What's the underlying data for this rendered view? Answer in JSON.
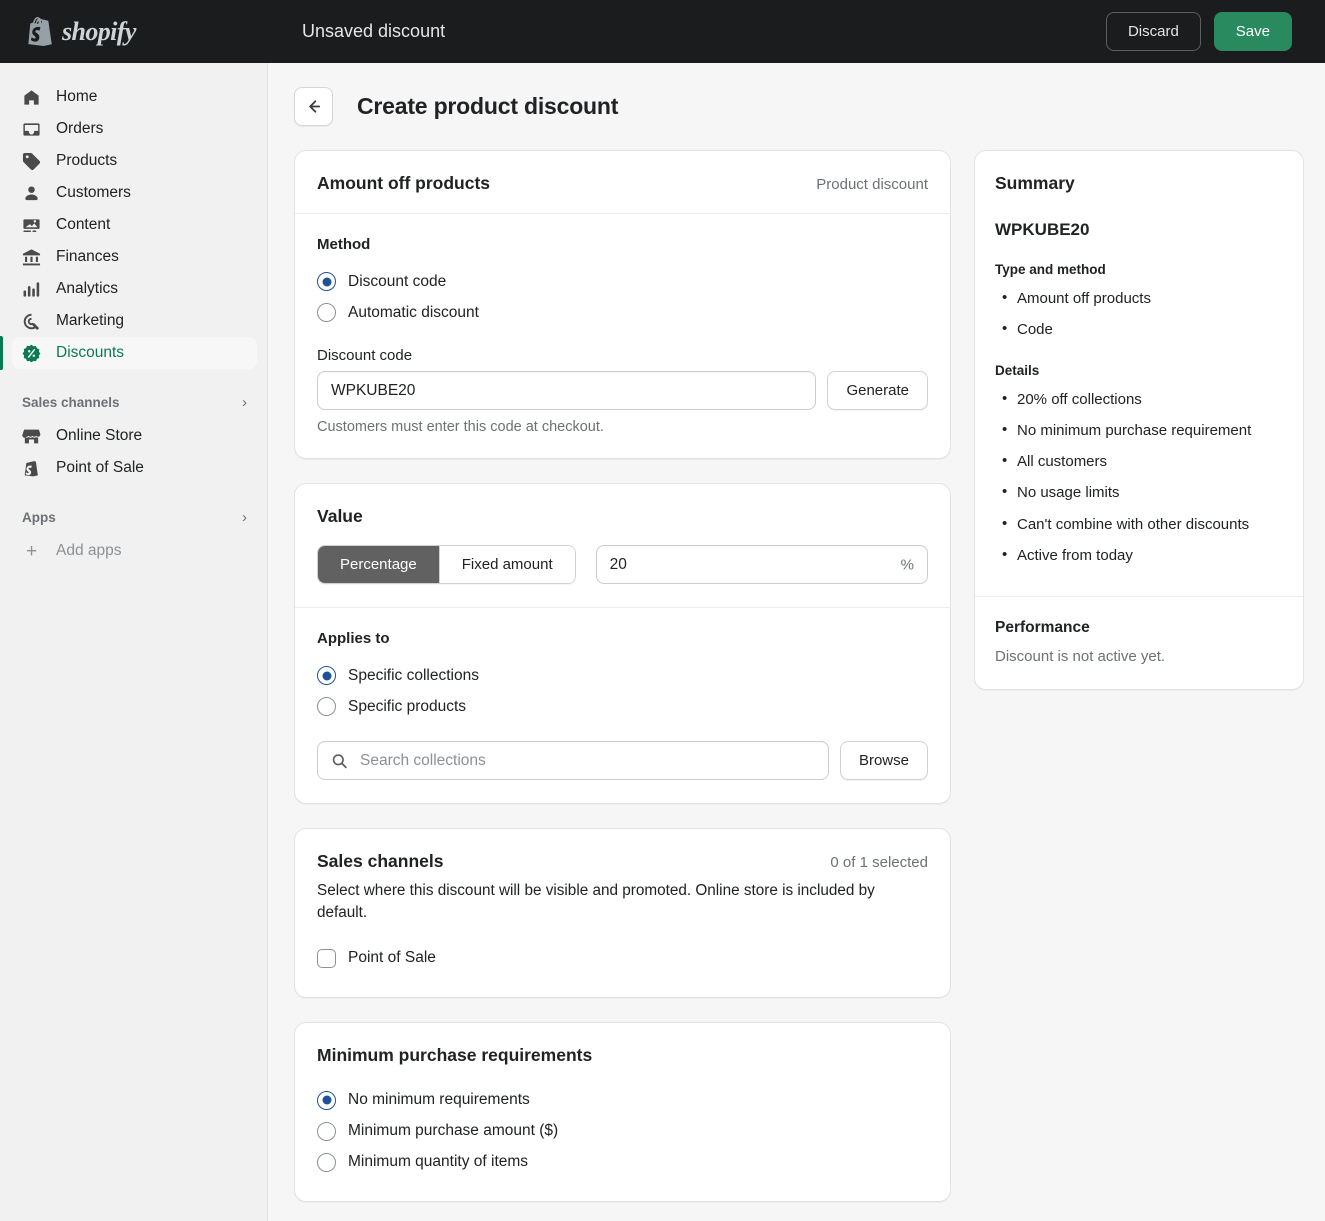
{
  "topbar": {
    "brand": "shopify",
    "brand_icon": "shopify-bag-icon",
    "document_title": "Unsaved discount",
    "discard_label": "Discard",
    "save_label": "Save",
    "save_color": "#2a8a5f",
    "background": "#1a1c1d"
  },
  "sidebar": {
    "items": [
      {
        "label": "Home",
        "icon": "home-icon"
      },
      {
        "label": "Orders",
        "icon": "orders-inbox-icon"
      },
      {
        "label": "Products",
        "icon": "product-tag-icon"
      },
      {
        "label": "Customers",
        "icon": "person-icon"
      },
      {
        "label": "Content",
        "icon": "content-image-icon"
      },
      {
        "label": "Finances",
        "icon": "bank-icon"
      },
      {
        "label": "Analytics",
        "icon": "bar-chart-icon"
      },
      {
        "label": "Marketing",
        "icon": "marketing-target-icon"
      },
      {
        "label": "Discounts",
        "icon": "discount-badge-icon"
      }
    ],
    "active_item": "Discounts",
    "active_color": "#0b7a53",
    "sections": [
      {
        "label": "Sales channels",
        "chevron": "chevron-right-icon",
        "items": [
          {
            "label": "Online Store",
            "icon": "storefront-icon"
          },
          {
            "label": "Point of Sale",
            "icon": "pos-icon"
          }
        ]
      },
      {
        "label": "Apps",
        "chevron": "chevron-right-icon",
        "items": []
      }
    ],
    "add_apps_label": "Add apps",
    "add_apps_icon": "plus-icon"
  },
  "page": {
    "back_icon": "arrow-left-icon",
    "title": "Create product discount"
  },
  "amount_off_card": {
    "title": "Amount off products",
    "meta": "Product discount",
    "method_label": "Method",
    "method_options": [
      {
        "label": "Discount code",
        "selected": true
      },
      {
        "label": "Automatic discount",
        "selected": false
      }
    ],
    "discount_code_label": "Discount code",
    "discount_code_value": "WPKUBE20",
    "generate_label": "Generate",
    "helper": "Customers must enter this code at checkout."
  },
  "value_card": {
    "title": "Value",
    "segments": [
      {
        "label": "Percentage",
        "selected": true
      },
      {
        "label": "Fixed amount",
        "selected": false
      }
    ],
    "amount_value": "20",
    "amount_suffix": "%",
    "applies_to_label": "Applies to",
    "applies_to_options": [
      {
        "label": "Specific collections",
        "selected": true
      },
      {
        "label": "Specific products",
        "selected": false
      }
    ],
    "search_placeholder": "Search collections",
    "search_icon": "search-icon",
    "browse_label": "Browse"
  },
  "sales_channels_card": {
    "title": "Sales channels",
    "meta": "0 of 1 selected",
    "description": "Select where this discount will be visible and promoted. Online store is included by default.",
    "channels": [
      {
        "label": "Point of Sale",
        "checked": false
      }
    ]
  },
  "minimum_card": {
    "title": "Minimum purchase requirements",
    "options": [
      {
        "label": "No minimum requirements",
        "selected": true
      },
      {
        "label": "Minimum purchase amount ($)",
        "selected": false
      },
      {
        "label": "Minimum quantity of items",
        "selected": false
      }
    ]
  },
  "summary": {
    "title": "Summary",
    "code": "WPKUBE20",
    "type_method_label": "Type and method",
    "type_method_items": [
      "Amount off products",
      "Code"
    ],
    "details_label": "Details",
    "details_items": [
      "20% off collections",
      "No minimum purchase requirement",
      "All customers",
      "No usage limits",
      "Can't combine with other discounts",
      "Active from today"
    ],
    "performance_label": "Performance",
    "performance_text": "Discount is not active yet."
  }
}
